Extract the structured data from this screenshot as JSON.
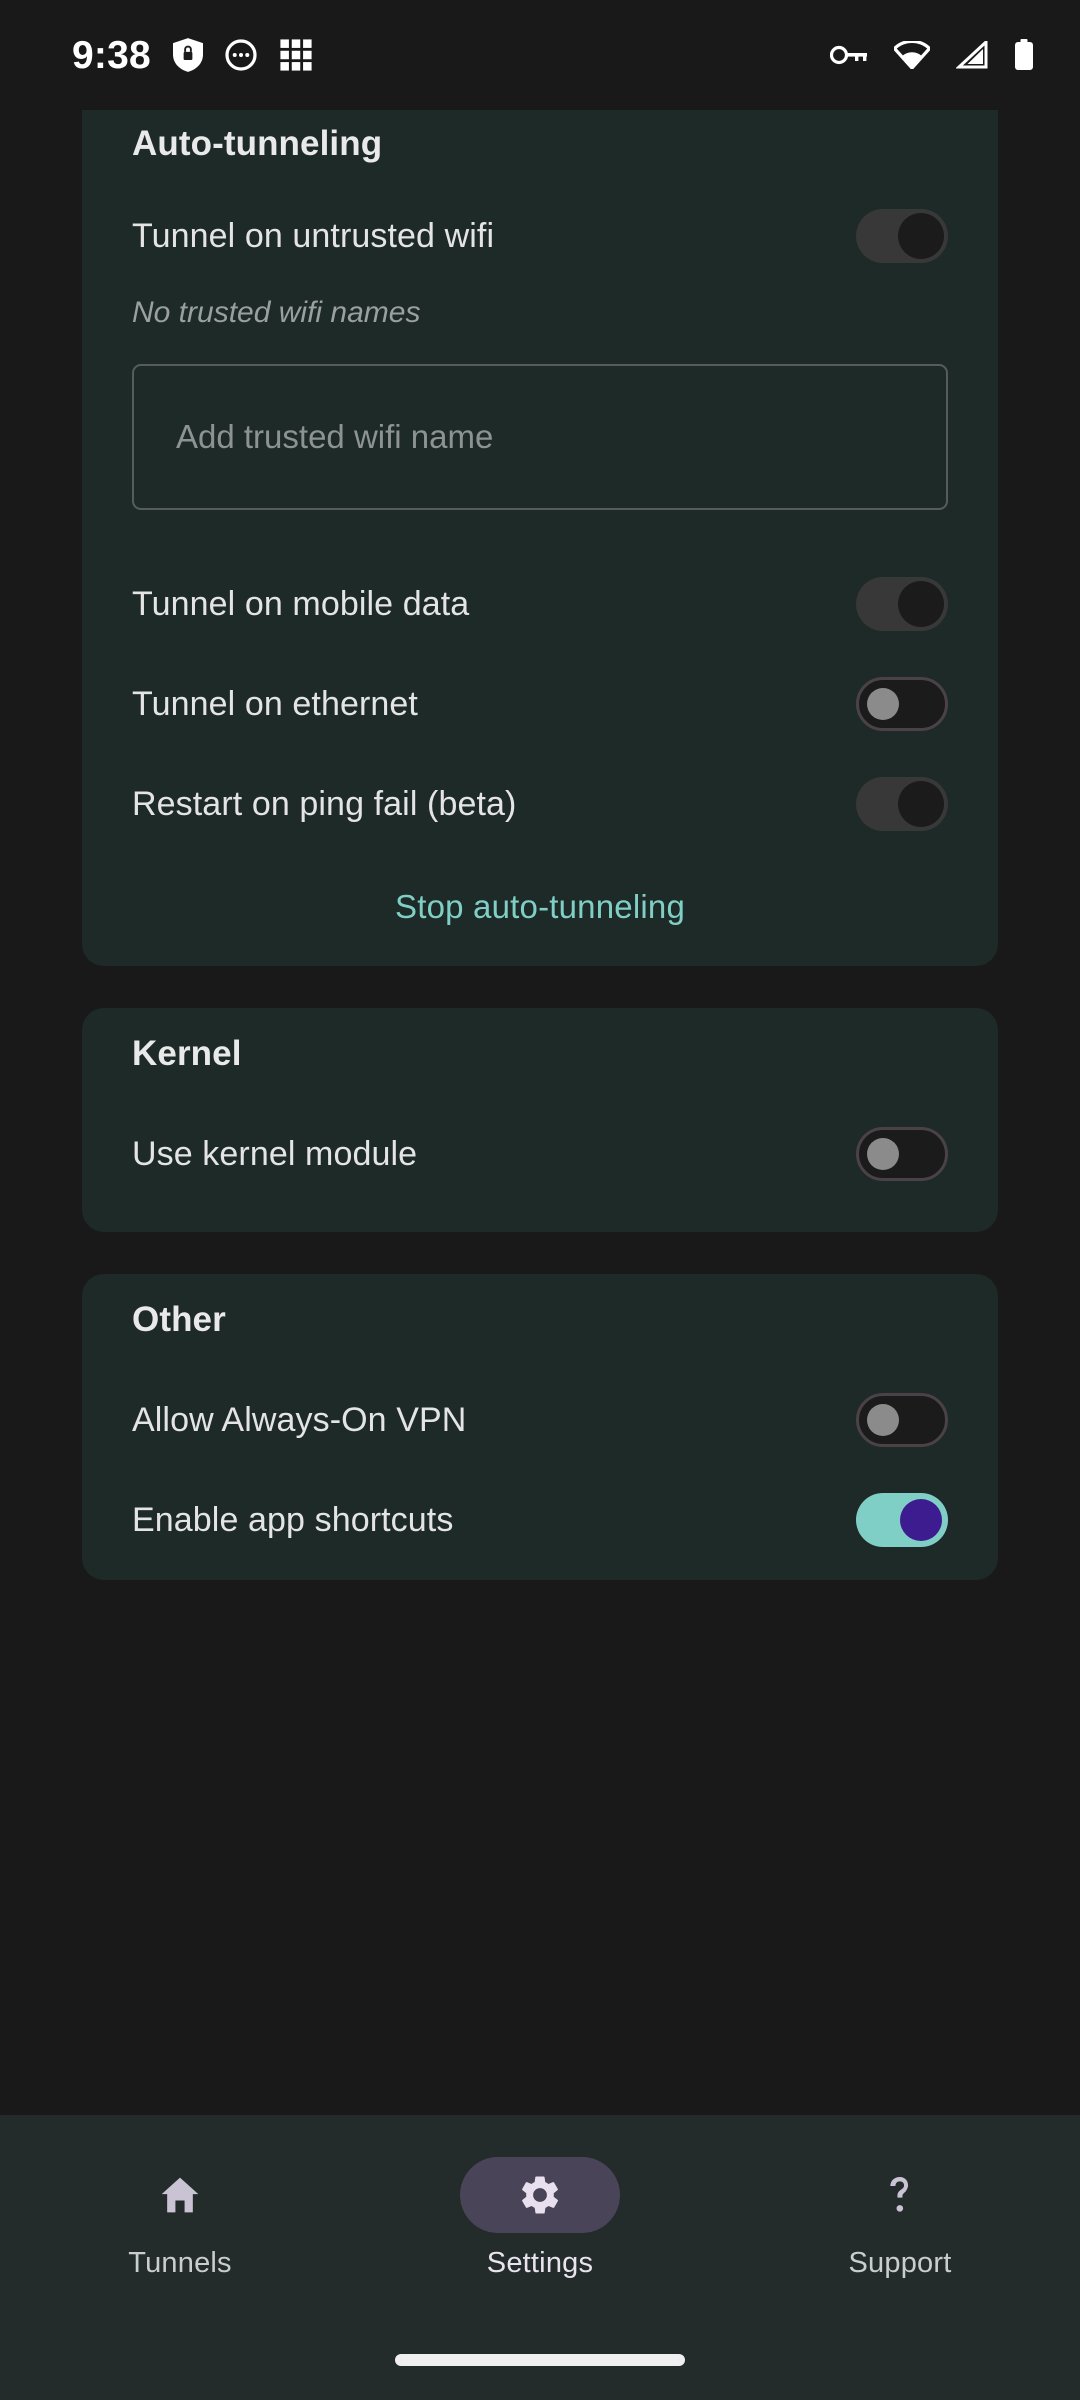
{
  "status_bar": {
    "time": "9:38",
    "left_icons": [
      "shield-lock-icon",
      "dots-circle-icon",
      "app-grid-icon"
    ],
    "right_icons": [
      "vpn-key-icon",
      "wifi-icon",
      "cellular-signal-icon",
      "battery-full-icon"
    ]
  },
  "sections": [
    {
      "title": "Auto-tunneling",
      "rows": [
        {
          "label": "Tunnel on untrusted wifi",
          "toggle": "disabled-on"
        }
      ],
      "helper_text": "No trusted wifi names",
      "textfield": {
        "value": "",
        "placeholder": "Add trusted wifi name"
      },
      "rows2": [
        {
          "label": "Tunnel on mobile data",
          "toggle": "disabled-on"
        },
        {
          "label": "Tunnel on ethernet",
          "toggle": "off"
        },
        {
          "label": "Restart on ping fail (beta)",
          "toggle": "disabled-on"
        }
      ],
      "action_link": "Stop auto-tunneling"
    },
    {
      "title": "Kernel",
      "rows": [
        {
          "label": "Use kernel module",
          "toggle": "off"
        }
      ]
    },
    {
      "title": "Other",
      "rows": [
        {
          "label": "Allow Always-On VPN",
          "toggle": "off"
        },
        {
          "label": "Enable app shortcuts",
          "toggle": "on"
        }
      ]
    }
  ],
  "bottom_nav": [
    {
      "label": "Tunnels",
      "icon": "home-icon",
      "active": false
    },
    {
      "label": "Settings",
      "icon": "gear-icon",
      "active": true
    },
    {
      "label": "Support",
      "icon": "question-mark-icon",
      "active": false
    }
  ],
  "colors": {
    "page_bg": "#191919",
    "card_bg": "#1e2a28",
    "accent_teal": "#7fcfc6",
    "accent_purple": "#3d1c90",
    "nav_active_pill": "#4a4458",
    "nav_bg": "#232b2b"
  }
}
